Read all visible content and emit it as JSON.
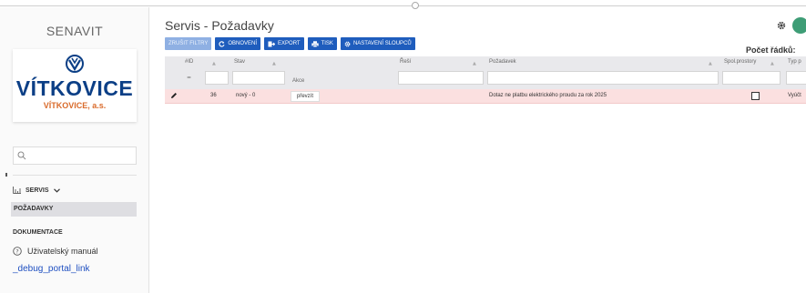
{
  "sidebar": {
    "brand": "SENAVIT",
    "logo": {
      "wordmark": "VÍTKOVICE",
      "subtitle": "VÍTKOVICE, a.s."
    },
    "search": {
      "placeholder": ""
    },
    "nav": {
      "servis_label": "SERVIS",
      "active_item": "POŽADAVKY",
      "section_label": "DOKUMENTACE",
      "manual_label": "Uživatelský manuál",
      "debug_link": "_debug_portal_link"
    }
  },
  "header": {
    "title": "Servis - Požadavky",
    "rows_label": "Počet řádků:"
  },
  "toolbar": {
    "clear_filters": "ZRUŠIT FILTRY",
    "refresh": "OBNOVENÍ",
    "export": "EXPORT",
    "print": "TISK",
    "columns": "NASTAVENÍ SLOUPCŮ"
  },
  "table": {
    "columns": {
      "id": "#ID",
      "status": "Stav",
      "action": "Akce",
      "solver": "Řeší",
      "request": "Požadavek",
      "shared": "Spol.prostory",
      "type": "Typ p"
    },
    "id_filter_op": "=",
    "rows": [
      {
        "id": "36",
        "status": "nový - 0",
        "action": "převzít",
        "solver": "",
        "request": "Dotaz ne platbu elektrického proudu za rok 2025",
        "shared": false,
        "type": "Vyúčt"
      }
    ]
  },
  "colors": {
    "primary": "#1f5dbd",
    "row_highlight": "#fbe0e0",
    "logo_blue": "#0c3f86",
    "logo_orange": "#d96a2a",
    "avatar": "#3e9d76"
  }
}
